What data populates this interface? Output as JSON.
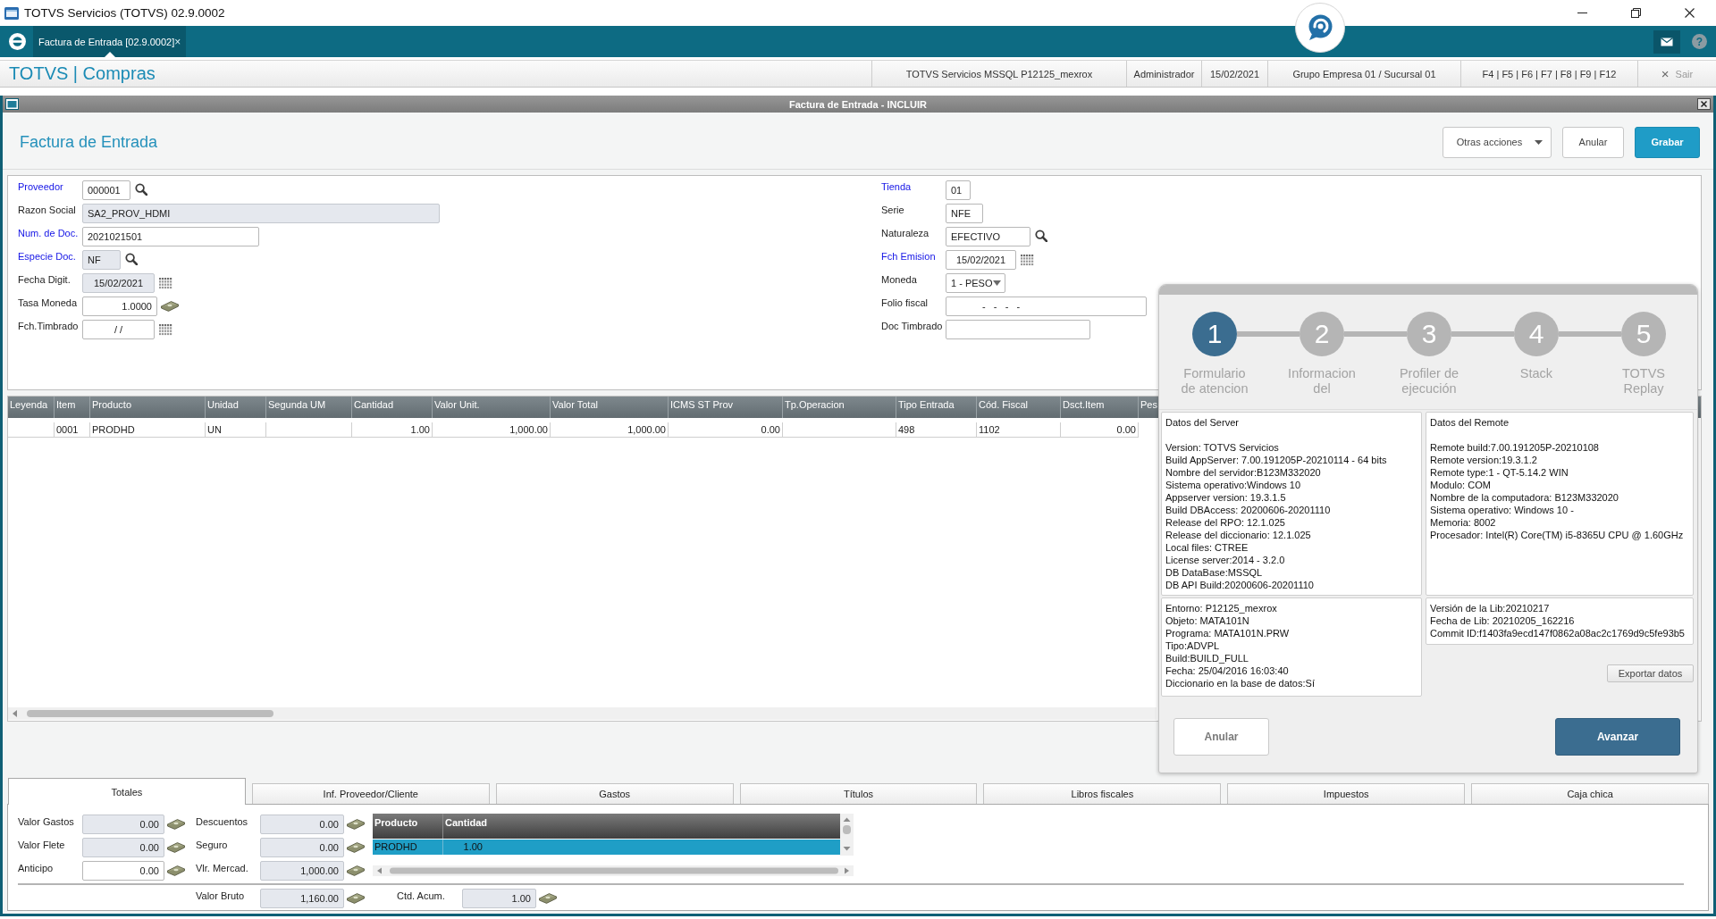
{
  "window": {
    "title": "TOTVS Servicios (TOTVS) 02.9.0002"
  },
  "app_bar": {
    "tabs": [
      {
        "label": "Factura de Entrada [02.9.0002]",
        "close": "×",
        "selected": true
      }
    ],
    "help": "?"
  },
  "header": {
    "module": "TOTVS | Compras",
    "info": [
      "TOTVS Servicios MSSQL P12125_mexrox",
      "Administrador",
      "15/02/2021",
      "Grupo Empresa 01 / Sucursal 01",
      "F4 | F5 | F6 | F7 | F8 | F9 | F12"
    ],
    "exit": {
      "icon": "×",
      "label": "Sair"
    }
  },
  "form_window": {
    "title": "Factura de Entrada - INCLUIR"
  },
  "page": {
    "title": "Factura de Entrada",
    "buttons": [
      {
        "label": "Otras acciones",
        "kind": "menu"
      },
      {
        "label": "Anular",
        "kind": "default"
      },
      {
        "label": "Grabar",
        "kind": "primary"
      }
    ]
  },
  "form": {
    "left": [
      {
        "label": "Proveedor",
        "required": true,
        "value": "000001",
        "kind": "lookup",
        "disabled": false
      },
      {
        "label": "Razon Social",
        "required": false,
        "value": "SA2_PROV_HDMI",
        "kind": "text",
        "disabled": true
      },
      {
        "label": "Num. de Doc.",
        "required": true,
        "value": "2021021501",
        "kind": "text",
        "disabled": false
      },
      {
        "label": "Especie Doc.",
        "required": true,
        "value": "NF",
        "kind": "lookup",
        "disabled": true
      },
      {
        "label": "Fecha Digit.",
        "required": false,
        "value": "15/02/2021",
        "kind": "date",
        "disabled": true
      },
      {
        "label": "Tasa Moneda",
        "required": false,
        "value": "1.0000",
        "kind": "amount",
        "disabled": false
      },
      {
        "label": "Fch.Timbrado",
        "required": false,
        "value": "/ /",
        "kind": "date",
        "disabled": false
      }
    ],
    "right": [
      {
        "label": "Tienda",
        "required": true,
        "value": "01",
        "kind": "text",
        "disabled": false
      },
      {
        "label": "Serie",
        "required": false,
        "value": "NFE",
        "kind": "text",
        "disabled": false
      },
      {
        "label": "Naturaleza",
        "required": false,
        "value": "EFECTIVO",
        "kind": "lookup",
        "disabled": false
      },
      {
        "label": "Fch Emision",
        "required": true,
        "value": "15/02/2021",
        "kind": "date",
        "disabled": false
      },
      {
        "label": "Moneda",
        "required": false,
        "value": "1 - PESO",
        "kind": "select",
        "disabled": false
      },
      {
        "label": "Folio fiscal",
        "required": false,
        "value": "-   -   -   -",
        "kind": "text",
        "disabled": false
      },
      {
        "label": "Doc Timbrado",
        "required": false,
        "kind": "text",
        "disabled": false
      }
    ]
  },
  "grid": {
    "columns": [
      "Leyenda",
      "Item",
      "Producto",
      "Unidad",
      "Segunda UM",
      "Cantidad",
      "Valor Unit.",
      "Valor Total",
      "ICMS ST Prov",
      "Tp.Operacion",
      "Tipo Entrada",
      "Cód. Fiscal",
      "Dsct.Item",
      "Pes"
    ],
    "rows": [
      {
        "cells": [
          null,
          "0001",
          "PRODHD",
          "UN",
          null,
          "1.00",
          "1,000.00",
          "1,000.00",
          "0.00",
          null,
          "498",
          "1102",
          "0.00"
        ]
      }
    ]
  },
  "folder_tabs": [
    {
      "label": "Totales",
      "selected": true
    },
    {
      "label": "Inf. Proveedor/Cliente",
      "selected": false
    },
    {
      "label": "Gastos",
      "selected": false
    },
    {
      "label": "Títulos",
      "selected": false
    },
    {
      "label": "Libros fiscales",
      "selected": false
    },
    {
      "label": "Impuestos",
      "selected": false
    },
    {
      "label": "Caja chica",
      "selected": false
    }
  ],
  "totals": {
    "left": [
      {
        "label": "Valor Gastos",
        "value": "0.00",
        "disabled": true
      },
      {
        "label": "Valor Flete",
        "value": "0.00",
        "disabled": true
      },
      {
        "label": "Anticipo",
        "value": "0.00",
        "disabled": false
      }
    ],
    "middle": [
      {
        "label": "Descuentos",
        "value": "0.00",
        "disabled": true
      },
      {
        "label": "Seguro",
        "value": "0.00",
        "disabled": true
      },
      {
        "label": "Vlr. Mercad.",
        "value": "1,000.00",
        "disabled": true
      }
    ],
    "items": {
      "columns": [
        "Producto",
        "Cantidad"
      ],
      "rows": [
        {
          "cells": [
            "PRODHD",
            "1.00"
          ],
          "selected": true
        }
      ]
    },
    "footer": [
      {
        "label": "Valor Bruto",
        "value": "1,160.00",
        "disabled": true
      },
      {
        "label": "Ctd. Acum.",
        "value": "1.00",
        "disabled": true
      }
    ]
  },
  "support_dialog": {
    "steps": [
      {
        "number": "1",
        "label": "Formulario de atencion",
        "selected": true
      },
      {
        "number": "2",
        "label": "Informacion del",
        "selected": false
      },
      {
        "number": "3",
        "label": "Profiler de ejecución",
        "selected": false
      },
      {
        "number": "4",
        "label": "Stack",
        "selected": false
      },
      {
        "number": "5",
        "label": "TOTVS Replay",
        "selected": false
      }
    ],
    "panels": [
      {
        "title": "Datos del Server",
        "lines": [
          "Version: TOTVS Servicios",
          "Build AppServer: 7.00.191205P-20210114 - 64 bits",
          "Nombre del servidor:B123M332020",
          "Sistema operativo:Windows 10",
          "Appserver version: 19.3.1.5",
          "Build DBAccess: 20200606-20201110",
          "Release del RPO: 12.1.025",
          "Release del diccionario: 12.1.025",
          "Local files: CTREE",
          "License server:2014 - 3.2.0",
          "DB DataBase:MSSQL",
          "DB API Build:20200606-20201110"
        ]
      },
      {
        "title": "Datos del Remote",
        "lines": [
          "Remote build:7.00.191205P-20210108",
          "Remote version:19.3.1.2",
          "Remote type:1 - QT-5.14.2 WIN",
          "Modulo: COM",
          "Nombre de la computadora: B123M332020",
          "Sistema operativo: Windows 10 -",
          "Memoria: 8002",
          "Procesador: Intel(R) Core(TM) i5-8365U CPU @ 1.60GHz"
        ]
      },
      {
        "lines": [
          "Entorno: P12125_mexrox",
          "Objeto: MATA101N",
          "Programa: MATA101N.PRW",
          "Tipo:ADVPL",
          "Build:BUILD_FULL",
          "Fecha: 25/04/2016 16:03:40",
          "Diccionario en la base de datos:Sí"
        ]
      },
      {
        "lines": [
          "Versión de la Lib:20210217",
          "Fecha de Lib: 20210205_162216",
          "Commit ID:f1403fa9ecd147f0862a08ac2c1769d9c5fe93b5"
        ]
      }
    ],
    "export_button": "Exportar datos",
    "buttons": [
      {
        "label": "Anular",
        "kind": "default"
      },
      {
        "label": "Avanzar",
        "kind": "primary"
      }
    ]
  }
}
